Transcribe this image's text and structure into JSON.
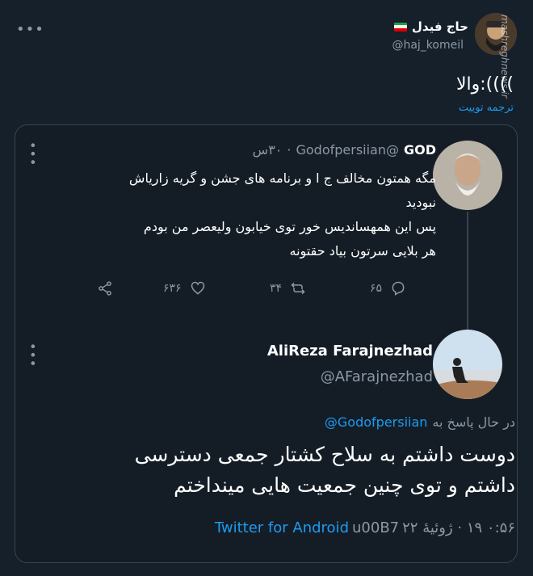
{
  "main_tweet": {
    "display_name": "حاج فیدل",
    "handle": "@haj_komeil",
    "text": "والا:((((",
    "translate_label": "ترجمه توییت",
    "more_icon": "more-horizontal-icon",
    "flag_icon": "iran-flag-icon"
  },
  "quoted": {
    "author": {
      "display_name": "GOD",
      "handle": "@Godofpersiian",
      "time": "۳۰س"
    },
    "text_lines": [
      "مگه همتون مخالف ج ا و برنامه های جشن و گریه زاریاش",
      "نبودید",
      "پس این همهساندیس خور توی خیابون ولیعصر من بودم",
      "هر بلایی سرتون بیاد حقتونه"
    ],
    "actions": {
      "reply_count": "۶۵",
      "retweet_count": "۳۴",
      "like_count": "۶۳۶"
    },
    "reply": {
      "display_name": "AliReza Farajnezhad",
      "handle": "@AFarajnezhad",
      "replying_to_label": "در حال پاسخ به",
      "replying_to_handle": "@Godofpersiian",
      "text_lines": [
        "دوست داشتم به سلاح کشتار جمعی دسترسی",
        "داشتم و توی چنین جمعیت هایی مینداختم"
      ],
      "timestamp": "۰:۵۶ ۱۹ · ژوئیهٔ ۲۲",
      "separator": "u00B7",
      "client": "Twitter for Android"
    }
  },
  "watermark": "mashreghnews.ir",
  "colors": {
    "background": "#15202b",
    "card": "#141d26",
    "border": "#38444d",
    "secondary_text": "#8b98a5",
    "link": "#1d9bf0"
  }
}
